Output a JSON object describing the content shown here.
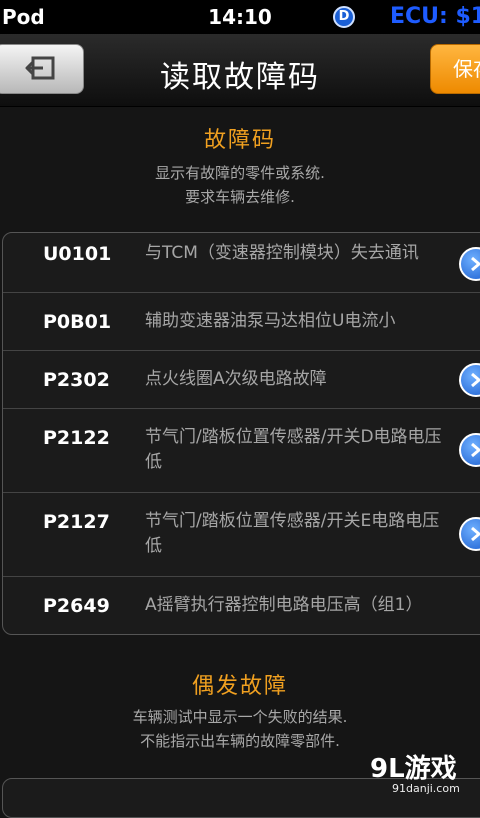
{
  "status_bar": {
    "carrier": "Pod",
    "time": "14:10",
    "badge": "D",
    "ecu": "ECU: $1"
  },
  "nav": {
    "title": "读取故障码",
    "save_label": "保存"
  },
  "fault_section": {
    "title": "故障码",
    "desc_line1": "显示有故障的零件或系统.",
    "desc_line2": "要求车辆去维修."
  },
  "faults": [
    {
      "code": "U0101",
      "desc": "与TCM（变速器控制模块）失去通讯",
      "has_detail": true
    },
    {
      "code": "P0B01",
      "desc": "辅助变速器油泵马达相位U电流小",
      "has_detail": false
    },
    {
      "code": "P2302",
      "desc": "点火线圈A次级电路故障",
      "has_detail": true
    },
    {
      "code": "P2122",
      "desc": "节气门/踏板位置传感器/开关D电路电压低",
      "has_detail": true
    },
    {
      "code": "P2127",
      "desc": "节气门/踏板位置传感器/开关E电路电压低",
      "has_detail": true
    },
    {
      "code": "P2649",
      "desc": "A摇臂执行器控制电路电压高（组1）",
      "has_detail": false
    }
  ],
  "intermittent_section": {
    "title": "偶发故障",
    "desc_line1": "车辆测试中显示一个失败的结果.",
    "desc_line2": "不能指示出车辆的故障零部件."
  },
  "watermark": {
    "main": "9L游戏",
    "sub": "91danji.com"
  }
}
